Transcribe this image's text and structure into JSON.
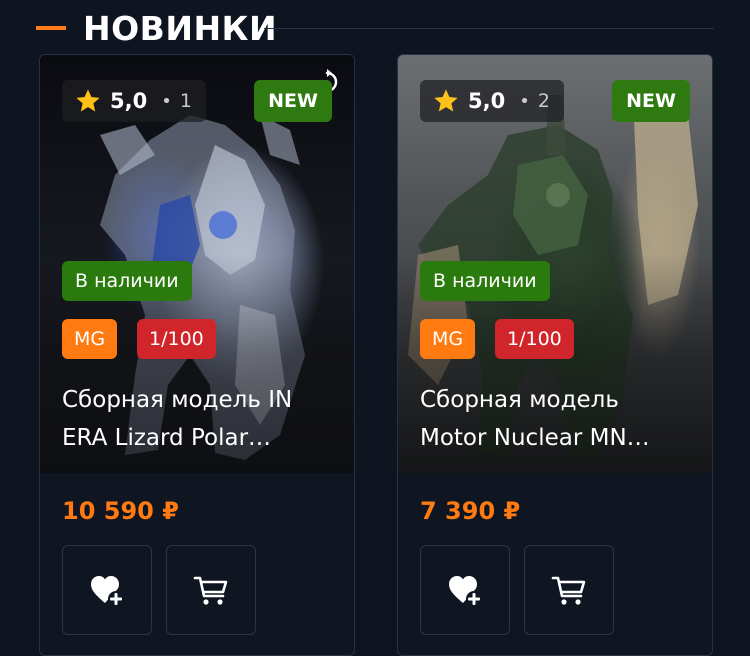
{
  "section": {
    "title": "НОВИНКИ"
  },
  "colors": {
    "accent": "#ff7a10",
    "new_badge": "#2f7a10",
    "stock_badge": "#2a7a0e",
    "grade_badge": "#ff7a10",
    "scale_badge": "#d0262b",
    "background": "#0e1520"
  },
  "products": [
    {
      "rating": "5,0",
      "rating_separator": "•",
      "review_count": "1",
      "new_label": "NEW",
      "stock_label": "В наличии",
      "grade": "MG",
      "scale": "1/100",
      "title": "Сборная модель IN ERA Lizard Polar…",
      "price": "10 590 ₽",
      "icons": [
        "star-icon",
        "favorite-add-icon",
        "cart-icon"
      ]
    },
    {
      "rating": "5,0",
      "rating_separator": "•",
      "review_count": "2",
      "new_label": "NEW",
      "stock_label": "В наличии",
      "grade": "MG",
      "scale": "1/100",
      "title": "Сборная модель Motor Nuclear MN…",
      "price": "7 390 ₽",
      "icons": [
        "star-icon",
        "favorite-add-icon",
        "cart-icon"
      ]
    }
  ]
}
